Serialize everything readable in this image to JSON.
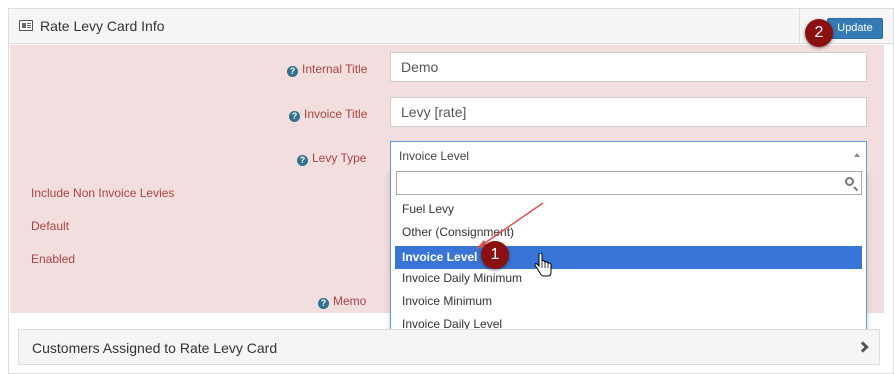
{
  "panel": {
    "title": "Rate Levy Card Info",
    "update_label": "Update"
  },
  "badges": {
    "step_1": "1",
    "step_2": "2"
  },
  "form": {
    "internal_title": {
      "label": "Internal Title",
      "value": "Demo"
    },
    "invoice_title": {
      "label": "Invoice Title",
      "value": "Levy [rate]"
    },
    "levy_type": {
      "label": "Levy Type",
      "value": "Invoice Level"
    },
    "include_non_invoice_levies": {
      "label": "Include Non Invoice Levies"
    },
    "default": {
      "label": "Default"
    },
    "enabled": {
      "label": "Enabled"
    },
    "memo": {
      "label": "Memo"
    }
  },
  "dropdown": {
    "search_value": "",
    "options": [
      "Fuel Levy",
      "Other (Consignment)",
      "Invoice Level",
      "Invoice Daily Minimum",
      "Invoice Minimum",
      "Invoice Daily Level"
    ],
    "highlighted_option": "Invoice Level"
  },
  "customers_panel": {
    "title": "Customers Assigned to Rate Levy Card"
  },
  "colors": {
    "accent": "#337ab7",
    "error_bg": "#f2dede",
    "error_text": "#a94442",
    "highlight": "#3875d7",
    "badge": "#8b1010"
  }
}
